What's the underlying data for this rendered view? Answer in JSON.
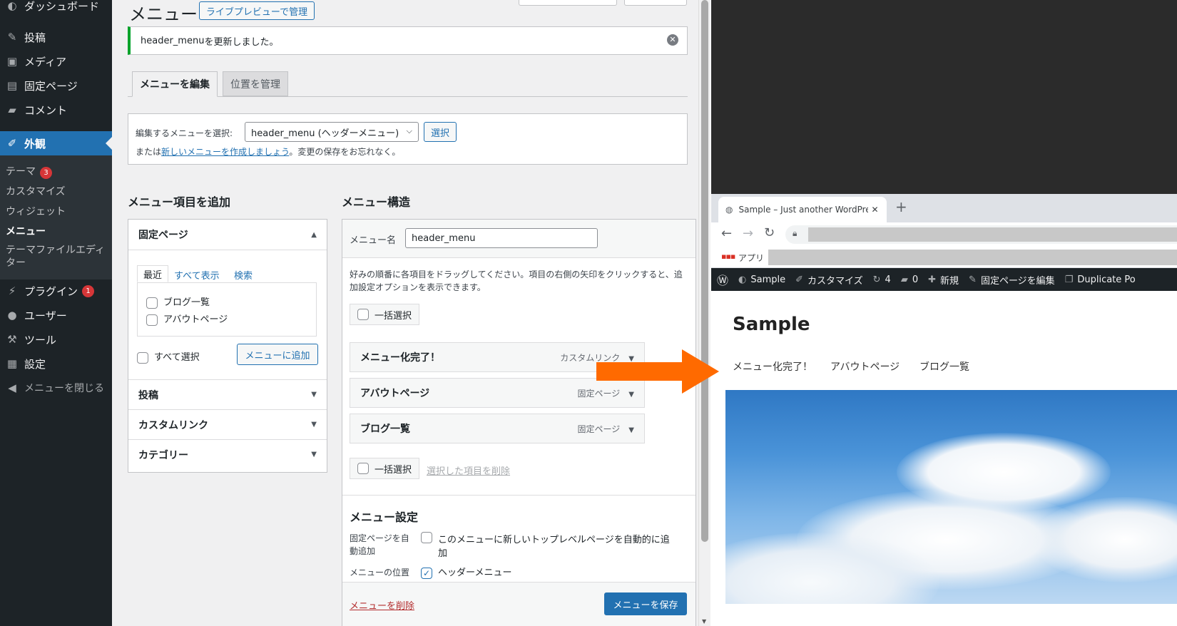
{
  "sidebar": {
    "dashboard": "ダッシュボード",
    "posts": "投稿",
    "media": "メディア",
    "pages": "固定ページ",
    "comments": "コメント",
    "appearance": "外観",
    "sub": {
      "themes": "テーマ",
      "themes_badge": "3",
      "customize": "カスタマイズ",
      "widgets": "ウィジェット",
      "menus": "メニュー",
      "theme_editor": "テーマファイルエディ",
      "theme_editor2": "ター"
    },
    "plugins": "プラグイン",
    "plugins_badge": "1",
    "users": "ユーザー",
    "tools": "ツール",
    "settings": "設定",
    "collapse": "メニューを閉じる"
  },
  "page": {
    "title": "メニュー",
    "live_preview": "ライブプレビューで管理",
    "notice_menu": "header_menu",
    "notice_text": " を更新しました。",
    "tab_edit": "メニューを編集",
    "tab_locations": "位置を管理",
    "select_label": "編集するメニューを選択:",
    "select_value": "header_menu (ヘッダーメニュー)",
    "select_button": "選択",
    "or_text": "または",
    "create_link": "新しいメニューを作成しましょう",
    "save_reminder": "。変更の保存をお忘れなく。"
  },
  "add_items": {
    "heading": "メニュー項目を追加",
    "pages_title": "固定ページ",
    "tab_recent": "最近",
    "tab_all": "すべて表示",
    "tab_search": "検索",
    "page_items": [
      "ブログ一覧",
      "アバウトページ"
    ],
    "select_all": "すべて選択",
    "add_button": "メニューに追加",
    "posts": "投稿",
    "custom_links": "カスタムリンク",
    "categories": "カテゴリー"
  },
  "structure": {
    "heading": "メニュー構造",
    "name_label": "メニュー名",
    "name_value": "header_menu",
    "instructions": "好みの順番に各項目をドラッグしてください。項目の右側の矢印をクリックすると、追加設定オプションを表示できます。",
    "bulk_select": "一括選択",
    "items": [
      {
        "title": "メニュー化完了！",
        "type": "カスタムリンク"
      },
      {
        "title": "アバウトページ",
        "type": "固定ページ"
      },
      {
        "title": "ブログ一覧",
        "type": "固定ページ"
      }
    ],
    "bulk_select2": "一括選択",
    "delete_selected": "選択した項目を削除",
    "settings_heading": "メニュー設定",
    "auto_add_label": "固定ページを自動追加",
    "auto_add_text": "このメニューに新しいトップレベルページを自動的に追加",
    "location_label": "メニューの位置",
    "location_header": "ヘッダーメニュー",
    "delete_menu": "メニューを削除",
    "save_menu": "メニューを保存"
  },
  "browser": {
    "tab_title": "Sample – Just another WordPres",
    "apps": "アプリ",
    "adminbar": {
      "site": "Sample",
      "customize": "カスタマイズ",
      "updates": "4",
      "comments": "0",
      "new": "新規",
      "edit_page": "固定ページを編集",
      "duplicate": "Duplicate Po"
    },
    "site_title": "Sample",
    "nav": [
      "メニュー化完了！",
      "アバウトページ",
      "ブログ一覧"
    ]
  },
  "colors": {
    "accent": "#2271b1",
    "sidebar_bg": "#1d2327",
    "active": "#2271b1",
    "arrow": "#ff6a00",
    "success": "#00a32a"
  }
}
